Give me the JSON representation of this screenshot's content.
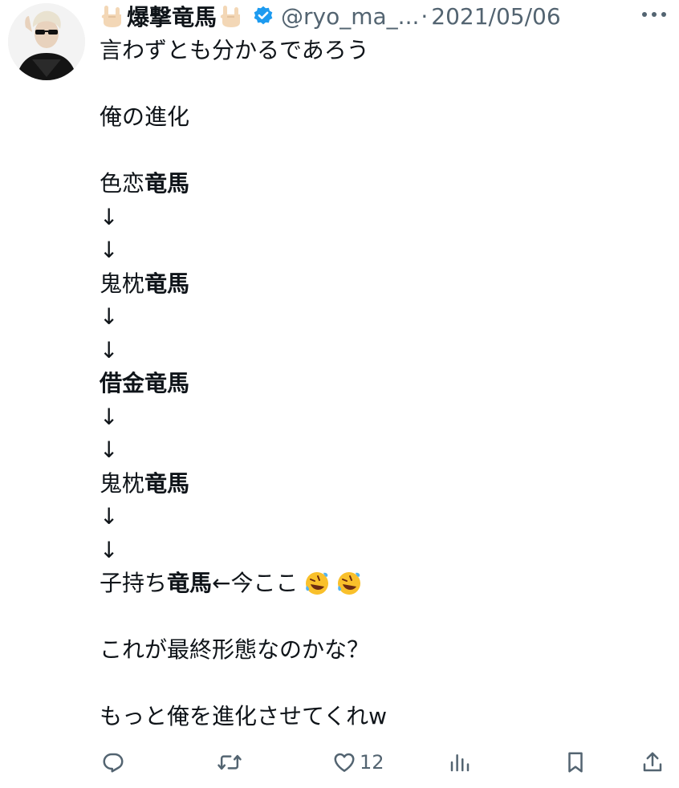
{
  "header": {
    "name": "爆撃竜馬",
    "name_emoji": "rock-on-hand-icon",
    "verified": true,
    "handle": "@ryo_ma_...",
    "separator": "·",
    "date": "2021/05/06"
  },
  "body": {
    "lines": [
      {
        "text": "言わずとも分かるであろう"
      },
      {
        "text": ""
      },
      {
        "text": "俺の進化"
      },
      {
        "text": ""
      },
      {
        "a": "色恋",
        "b": "竜馬"
      },
      {
        "text": "↓"
      },
      {
        "text": "↓"
      },
      {
        "a": "鬼枕",
        "b": "竜馬"
      },
      {
        "text": "↓"
      },
      {
        "text": "↓"
      },
      {
        "bold": "借金竜馬"
      },
      {
        "text": "↓"
      },
      {
        "text": "↓"
      },
      {
        "a": "鬼枕",
        "b": "竜馬"
      },
      {
        "text": "↓"
      },
      {
        "text": "↓"
      },
      {
        "a": "子持ち",
        "b": "竜馬",
        "c": "←今ここ",
        "emoji": "rofl-icon"
      },
      {
        "text": ""
      },
      {
        "text": "これが最終形態なのかな？"
      },
      {
        "text": ""
      },
      {
        "text": "もっと俺を進化させてくれw"
      }
    ]
  },
  "actions": {
    "reply_count": "",
    "retweet_count": "",
    "like_count": "12",
    "views_count": ""
  },
  "colors": {
    "text": "#0f1419",
    "muted": "#536471",
    "verified": "#1d9bf0"
  }
}
